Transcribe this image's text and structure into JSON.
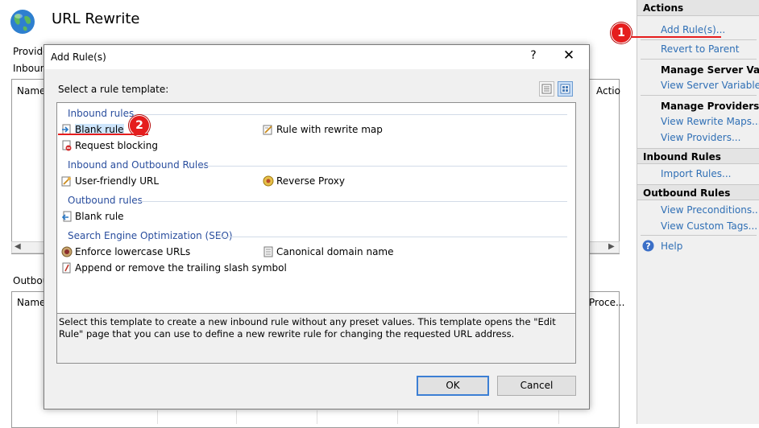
{
  "page": {
    "title": "URL Rewrite",
    "provider_text": "Provide",
    "inbound_text": "Inboun",
    "col_name": "Name",
    "col_action": "Actio",
    "outbound_text": "Outbou",
    "col_name2": "Name",
    "col_proc": "Proce..."
  },
  "actions": {
    "header": "Actions",
    "add_rules": "Add Rule(s)...",
    "revert_to_parent": "Revert to Parent",
    "manage_server_variables": "Manage Server Variab",
    "view_server_variables": "View Server Variables...",
    "manage_providers": "Manage Providers",
    "view_rewrite_maps": "View Rewrite Maps...",
    "view_providers": "View Providers...",
    "inbound_rules": "Inbound Rules",
    "import_rules": "Import Rules...",
    "outbound_rules": "Outbound Rules",
    "view_preconditions": "View Preconditions...",
    "view_custom_tags": "View Custom Tags...",
    "help": "Help"
  },
  "dialog": {
    "title": "Add Rule(s)",
    "help_glyph": "?",
    "close_glyph": "✕",
    "prompt": "Select a rule template:",
    "groups": {
      "inbound": "Inbound rules",
      "inbound_outbound": "Inbound and Outbound Rules",
      "outbound": "Outbound rules",
      "seo": "Search Engine Optimization (SEO)"
    },
    "items": {
      "blank_rule": "Blank rule",
      "rule_with_rewrite_map": "Rule with rewrite map",
      "request_blocking": "Request blocking",
      "user_friendly_url": "User-friendly URL",
      "reverse_proxy": "Reverse Proxy",
      "outbound_blank_rule": "Blank rule",
      "enforce_lowercase": "Enforce lowercase URLs",
      "canonical_domain": "Canonical domain name",
      "trailing_slash": "Append or remove the trailing slash symbol"
    },
    "description": "Select this template to create a new inbound rule without any preset values. This template opens the \"Edit Rule\" page that you can use to define a new rewrite rule for changing the requested URL address.",
    "ok_label": "OK",
    "cancel_label": "Cancel"
  },
  "annotations": {
    "step1": "1",
    "step2": "2",
    "color": "#e51d1d"
  },
  "colors": {
    "link": "#2f6fb5",
    "group_heading": "#2a4e9e",
    "selection": "#cde5fb"
  }
}
